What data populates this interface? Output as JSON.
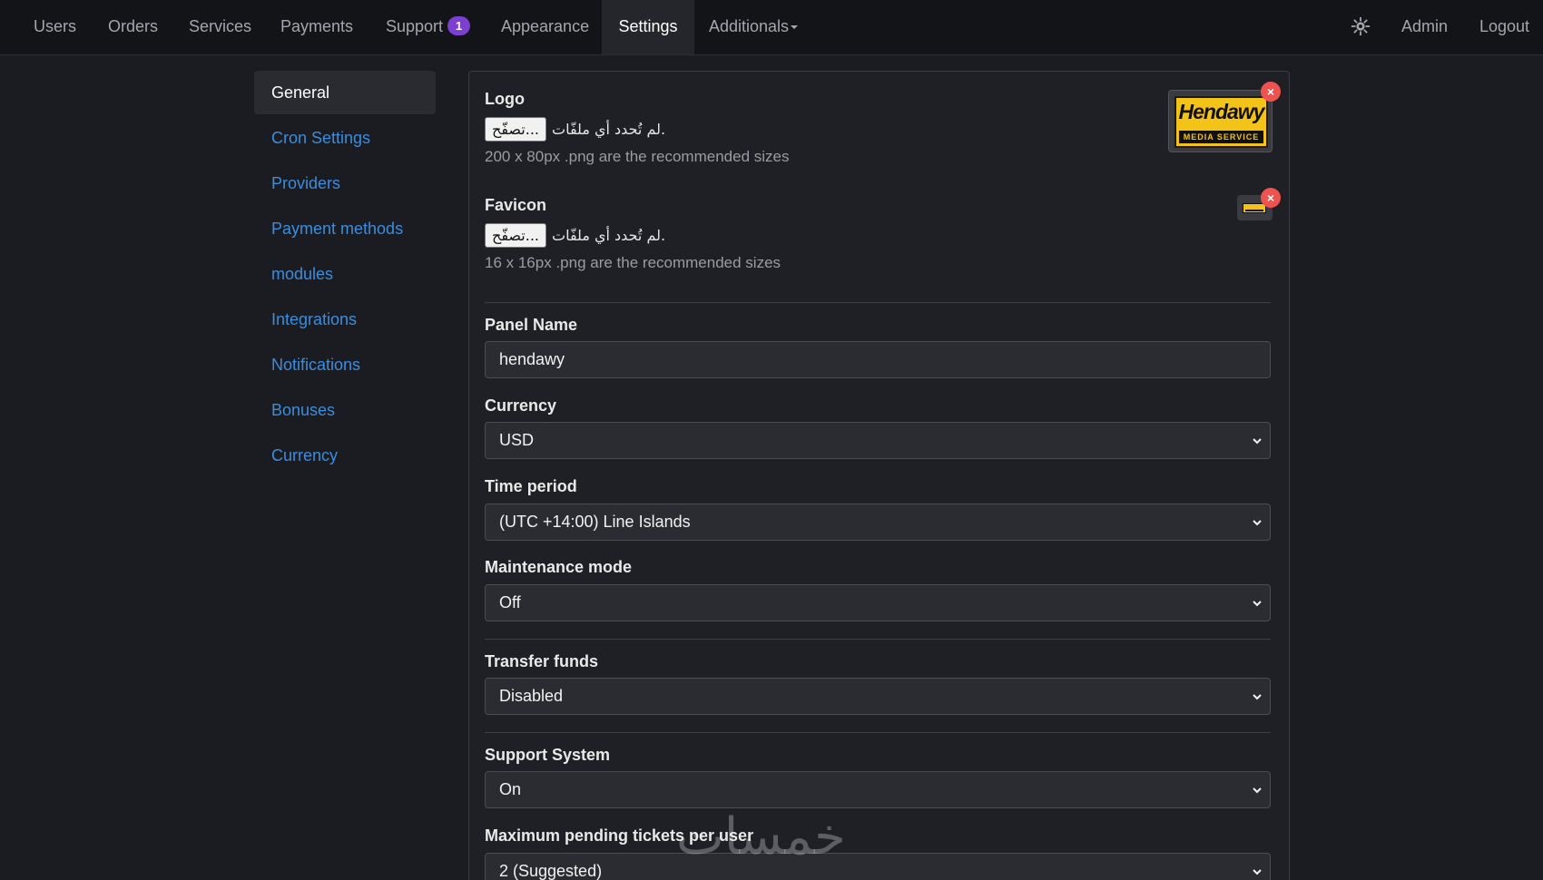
{
  "nav": {
    "items": [
      {
        "label": "Users"
      },
      {
        "label": "Orders"
      },
      {
        "label": "Services"
      },
      {
        "label": "Payments"
      },
      {
        "label": "Support",
        "badge": "1"
      },
      {
        "label": "Appearance"
      },
      {
        "label": "Settings",
        "active": true
      },
      {
        "label": "Additionals",
        "dropdown": true
      }
    ],
    "theme_icon": "gear-icon",
    "admin_label": "Admin",
    "logout_label": "Logout"
  },
  "sidebar": {
    "items": [
      {
        "label": "General",
        "active": true
      },
      {
        "label": "Cron Settings"
      },
      {
        "label": "Providers"
      },
      {
        "label": "Payment methods"
      },
      {
        "label": "modules"
      },
      {
        "label": "Integrations"
      },
      {
        "label": "Notifications"
      },
      {
        "label": "Bonuses"
      },
      {
        "label": "Currency"
      }
    ]
  },
  "form": {
    "logo": {
      "label": "Logo",
      "browse_label": "تصفّح...",
      "no_file_text": "لم تُحدد أي ملفّات.",
      "help": "200 x 80px .png are the recommended sizes",
      "preview_word": "Hendawy",
      "preview_sub": "MEDIA SERVICE"
    },
    "favicon": {
      "label": "Favicon",
      "browse_label": "تصفّح...",
      "no_file_text": "لم تُحدد أي ملفّات.",
      "help": "16 x 16px .png are the recommended sizes"
    },
    "remove_symbol": "×",
    "panel_name": {
      "label": "Panel Name",
      "value": "hendawy"
    },
    "currency": {
      "label": "Currency",
      "value": "USD"
    },
    "time_period": {
      "label": "Time period",
      "value": "(UTC +14:00) Line Islands"
    },
    "maintenance": {
      "label": "Maintenance mode",
      "value": "Off"
    },
    "transfer_funds": {
      "label": "Transfer funds",
      "value": "Disabled"
    },
    "support_system": {
      "label": "Support System",
      "value": "On"
    },
    "max_pending": {
      "label": "Maximum pending tickets per user",
      "value": "2 (Suggested)"
    }
  },
  "watermark": "خمسات",
  "colors": {
    "accent_link": "#3b8dde",
    "badge": "#7d3fd0",
    "remove": "#ef5350",
    "brand_yellow": "#f4c318"
  }
}
